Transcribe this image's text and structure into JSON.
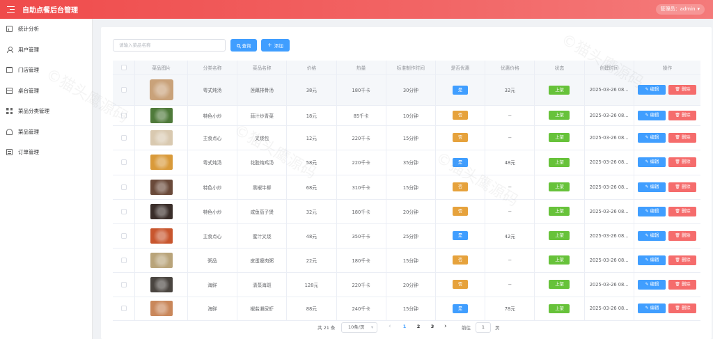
{
  "header": {
    "title": "自助点餐后台管理",
    "admin_label": "管理员：admin"
  },
  "sidebar": {
    "items": [
      {
        "label": "统计分析",
        "icon": "chart-icon"
      },
      {
        "label": "用户管理",
        "icon": "user-icon"
      },
      {
        "label": "门店管理",
        "icon": "shop-icon"
      },
      {
        "label": "桌台管理",
        "icon": "table-icon"
      },
      {
        "label": "菜品分类管理",
        "icon": "grid-icon"
      },
      {
        "label": "菜品管理",
        "icon": "dish-icon"
      },
      {
        "label": "订单管理",
        "icon": "order-icon"
      }
    ]
  },
  "toolbar": {
    "search_placeholder": "请输入菜品名称",
    "search_label": "查询",
    "add_label": "添加"
  },
  "table": {
    "columns": [
      "菜品图片",
      "分类名称",
      "菜品名称",
      "价格",
      "热量",
      "标准制作时间",
      "是否优惠",
      "优惠价格",
      "状态",
      "创建时间",
      "操作"
    ],
    "edit_label": "编辑",
    "delete_label": "删除",
    "rows": [
      {
        "category": "粤式炖汤",
        "name": "莲藕排骨汤",
        "price": "38元",
        "calories": "180千卡",
        "time": "30分钟",
        "discount": "是",
        "discount_price": "32元",
        "status": "上架",
        "created": "2025-03-26 08...",
        "image_color": "#c9a27a"
      },
      {
        "category": "特色小炒",
        "name": "蒜汁炒青菜",
        "price": "18元",
        "calories": "85千卡",
        "time": "10分钟",
        "discount": "否",
        "discount_price": "--",
        "status": "上架",
        "created": "2025-03-26 08...",
        "image_color": "#4f7a3a"
      },
      {
        "category": "主食点心",
        "name": "叉烧包",
        "price": "12元",
        "calories": "220千卡",
        "time": "15分钟",
        "discount": "否",
        "discount_price": "--",
        "status": "上架",
        "created": "2025-03-26 08...",
        "image_color": "#d9c9b0"
      },
      {
        "category": "粤式炖汤",
        "name": "花胶炖鸡汤",
        "price": "58元",
        "calories": "220千卡",
        "time": "35分钟",
        "discount": "是",
        "discount_price": "48元",
        "status": "上架",
        "created": "2025-03-26 08...",
        "image_color": "#d99a3a"
      },
      {
        "category": "特色小炒",
        "name": "黑椒牛柳",
        "price": "68元",
        "calories": "310千卡",
        "time": "15分钟",
        "discount": "否",
        "discount_price": "--",
        "status": "上架",
        "created": "2025-03-26 08...",
        "image_color": "#6a4a3a"
      },
      {
        "category": "特色小炒",
        "name": "咸鱼茄子煲",
        "price": "32元",
        "calories": "180千卡",
        "time": "20分钟",
        "discount": "否",
        "discount_price": "--",
        "status": "上架",
        "created": "2025-03-26 08...",
        "image_color": "#3a2e2a"
      },
      {
        "category": "主食点心",
        "name": "蜜汁叉烧",
        "price": "48元",
        "calories": "350千卡",
        "time": "25分钟",
        "discount": "是",
        "discount_price": "42元",
        "status": "上架",
        "created": "2025-03-26 08...",
        "image_color": "#c8562e"
      },
      {
        "category": "粥品",
        "name": "皮蛋瘦肉粥",
        "price": "22元",
        "calories": "180千卡",
        "time": "15分钟",
        "discount": "否",
        "discount_price": "--",
        "status": "上架",
        "created": "2025-03-26 08...",
        "image_color": "#b9a47a"
      },
      {
        "category": "海鲜",
        "name": "清蒸海斑",
        "price": "128元",
        "calories": "220千卡",
        "time": "20分钟",
        "discount": "否",
        "discount_price": "--",
        "status": "上架",
        "created": "2025-03-26 08...",
        "image_color": "#4a4540"
      },
      {
        "category": "海鲜",
        "name": "椒盐濑尿虾",
        "price": "88元",
        "calories": "240千卡",
        "time": "15分钟",
        "discount": "是",
        "discount_price": "78元",
        "status": "上架",
        "created": "2025-03-26 08...",
        "image_color": "#c9875a"
      }
    ]
  },
  "pagination": {
    "total": "共 21 条",
    "page_size": "10条/页",
    "pages": [
      "1",
      "2",
      "3"
    ],
    "current_page": "1",
    "goto_label": "前往",
    "goto_value": "1",
    "goto_unit": "页"
  },
  "colors": {
    "header_red": "#ef4b4b",
    "primary": "#409eff",
    "warning": "#e6a23c",
    "success": "#67c23a",
    "danger": "#f56c6c"
  }
}
